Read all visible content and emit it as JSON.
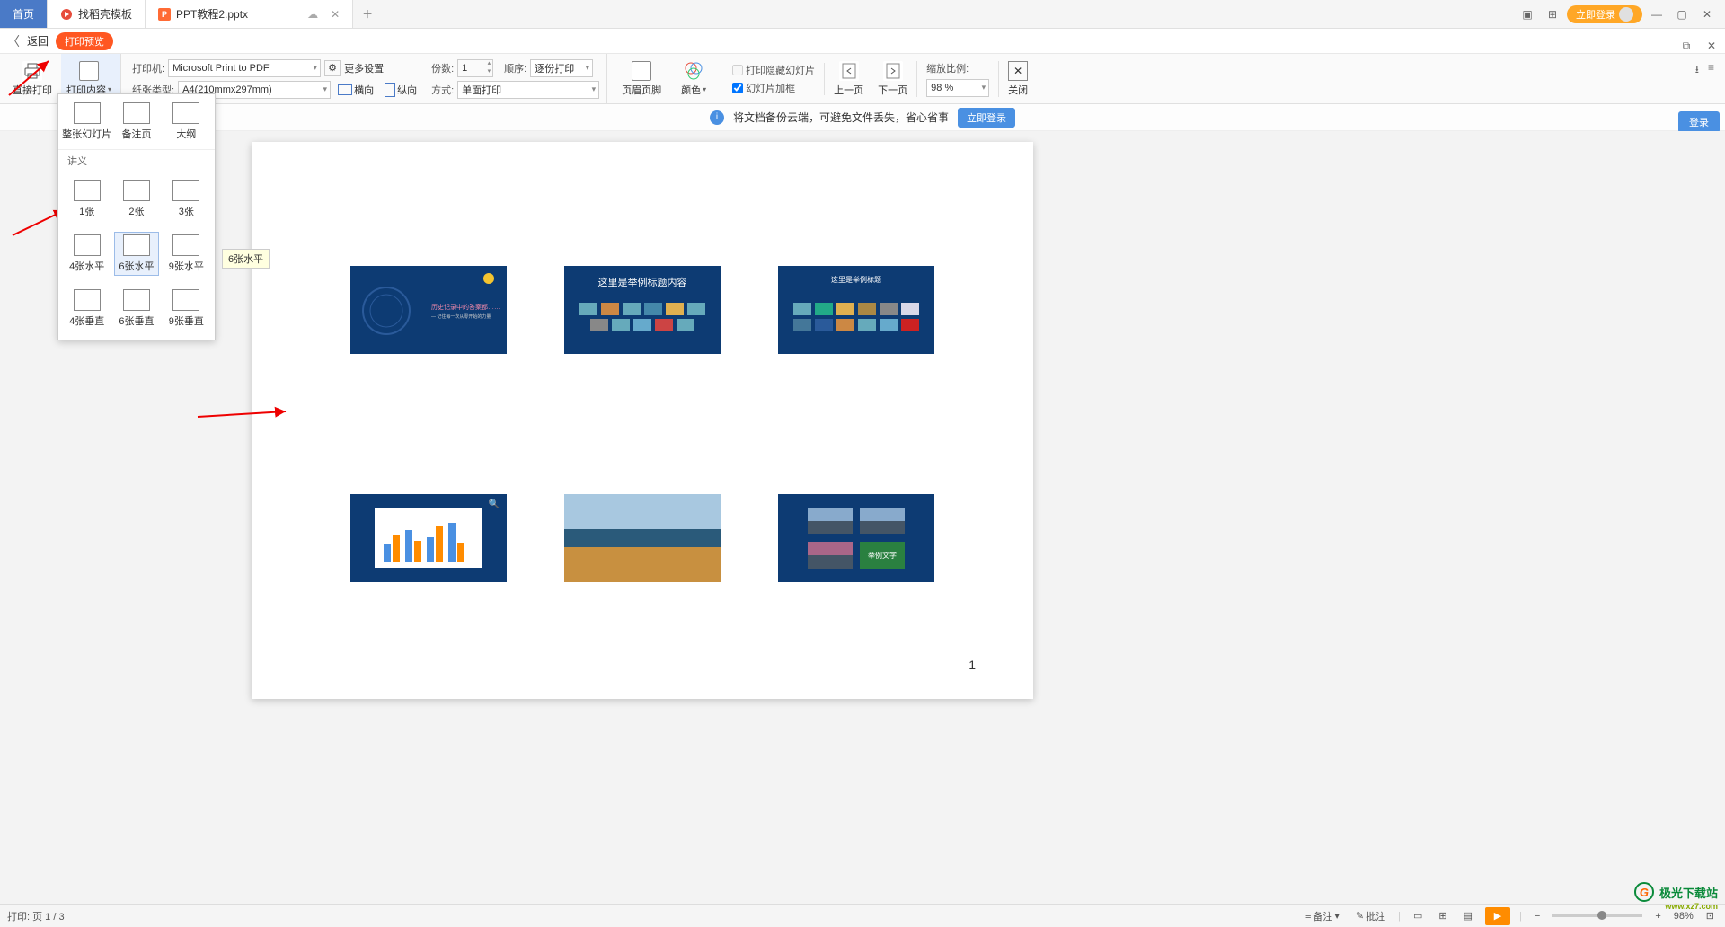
{
  "tabs": {
    "home": "首页",
    "template": "找稻壳模板",
    "doc": "PPT教程2.pptx"
  },
  "header": {
    "login": "立即登录"
  },
  "backrow": {
    "back": "返回",
    "pill": "打印预览"
  },
  "toolbar": {
    "direct_print": "直接打印",
    "print_content": "打印内容",
    "printer_label": "打印机:",
    "printer_value": "Microsoft Print to PDF",
    "paper_label": "纸张类型:",
    "paper_value": "A4(210mmx297mm)",
    "more_settings": "更多设置",
    "landscape": "横向",
    "portrait": "纵向",
    "copies_label": "份数:",
    "copies_value": "1",
    "method_label": "方式:",
    "method_value": "单面打印",
    "order_label": "顺序:",
    "order_value": "逐份打印",
    "header_footer": "页眉页脚",
    "color": "颜色",
    "hide_hidden": "打印隐藏幻灯片",
    "slide_frame": "幻灯片加框",
    "prev_page": "上一页",
    "next_page": "下一页",
    "scale_label": "缩放比例:",
    "scale_value": "98 %",
    "close": "关闭"
  },
  "dropdown": {
    "full_slide": "整张幻灯片",
    "notes_page": "备注页",
    "outline": "大纲",
    "section": "讲义",
    "one": "1张",
    "two": "2张",
    "three": "3张",
    "four_h": "4张水平",
    "six_h": "6张水平",
    "nine_h": "9张水平",
    "four_v": "4张垂直",
    "six_v": "6张垂直",
    "nine_v": "9张垂直",
    "tooltip": "6张水平"
  },
  "banner": {
    "text": "将文档备份云端，可避免文件丢失，省心省事",
    "login": "立即登录"
  },
  "right": {
    "login": "登录"
  },
  "preview": {
    "slide2_title": "这里是举例标题内容",
    "slide3_title": "这里是举例标题",
    "slide6_tag": "举例文字",
    "page_num": "1"
  },
  "statusbar": {
    "print_pages": "打印: 页 1 / 3",
    "notes": "备注",
    "comments": "批注",
    "zoom": "98%"
  },
  "watermark": {
    "name": "极光下载站",
    "url": "www.xz7.com"
  }
}
